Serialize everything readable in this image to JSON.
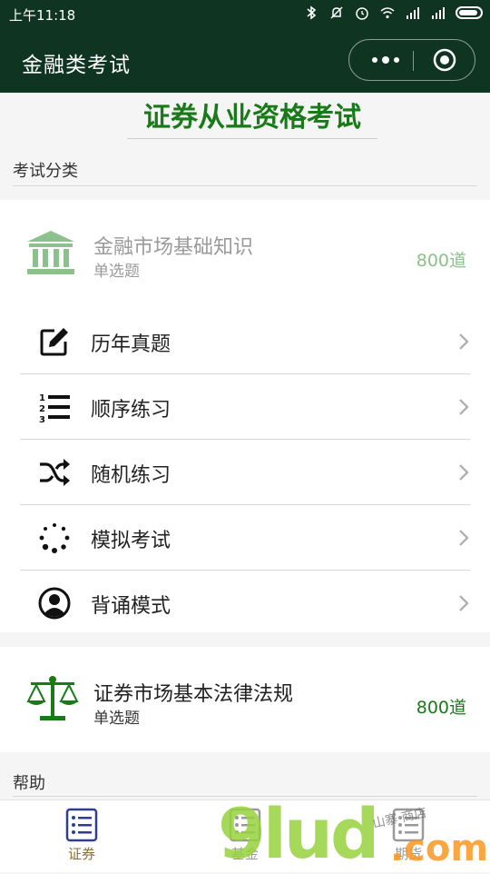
{
  "status_bar": {
    "time": "上午11:18"
  },
  "nav": {
    "title": "金融类考试"
  },
  "banner": {
    "title": "证券从业资格考试"
  },
  "sections": {
    "category": "考试分类",
    "help": "帮助"
  },
  "subject1": {
    "name": "金融市场基础知识",
    "type": "单选题",
    "count": "800道"
  },
  "menu": [
    {
      "label": "历年真题",
      "icon": "edit-icon"
    },
    {
      "label": "顺序练习",
      "icon": "ordered-list-icon"
    },
    {
      "label": "随机练习",
      "icon": "shuffle-icon"
    },
    {
      "label": "模拟考试",
      "icon": "spinner-icon"
    },
    {
      "label": "背诵模式",
      "icon": "user-circle-icon"
    }
  ],
  "subject2": {
    "name": "证券市场基本法律法规",
    "type": "单选题",
    "count": "800道"
  },
  "tabs": [
    {
      "label": "证券",
      "active": true
    },
    {
      "label": "基金",
      "active": false
    },
    {
      "label": "期货",
      "active": false
    }
  ],
  "watermark": {
    "brand": "9lud",
    "domain": ".com",
    "tagline": "山寨   商店"
  },
  "colors": {
    "header_bg": "#0f3522",
    "accent_green": "#1a7a1a",
    "muted_green": "#8cc08c",
    "tab_active": "#8a6e2e"
  }
}
